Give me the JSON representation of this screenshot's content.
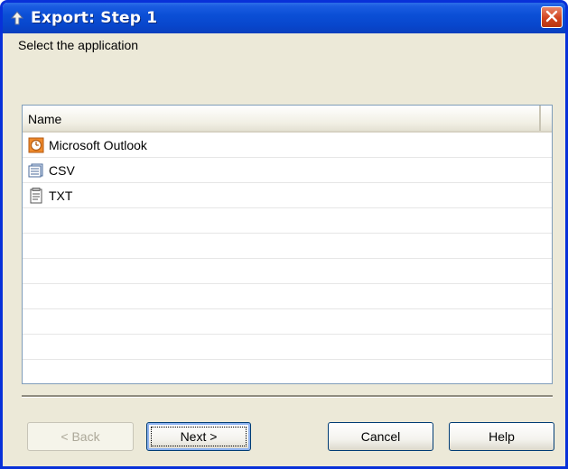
{
  "window": {
    "title": "Export: Step 1",
    "accent": "#0831d9"
  },
  "prompt": "Select the application",
  "list": {
    "column_header": "Name",
    "items": [
      {
        "label": "Microsoft Outlook",
        "icon": "outlook-clock-icon"
      },
      {
        "label": "CSV",
        "icon": "csv-file-icon"
      },
      {
        "label": "TXT",
        "icon": "txt-file-icon"
      }
    ]
  },
  "buttons": {
    "back": "< Back",
    "next": "Next >",
    "cancel": "Cancel",
    "help": "Help"
  }
}
